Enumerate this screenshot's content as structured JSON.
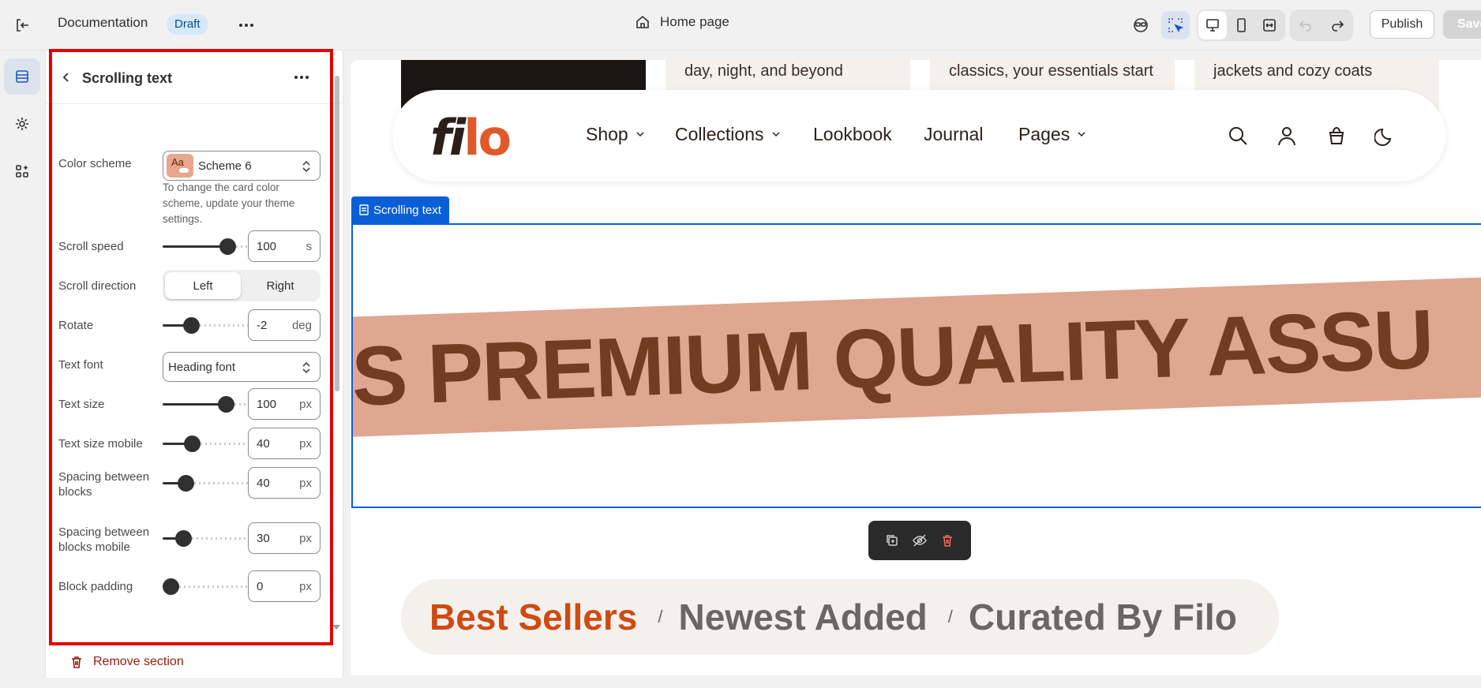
{
  "topbar": {
    "doc_name": "Documentation",
    "status_badge": "Draft",
    "page_name": "Home page",
    "publish_label": "Publish",
    "save_label": "Save"
  },
  "panel": {
    "title": "Scrolling text",
    "color_scheme": {
      "label": "Color scheme",
      "value": "Scheme 6",
      "swatch_text": "Aa",
      "help": "To change the card color scheme, update your theme settings."
    },
    "scroll_speed": {
      "label": "Scroll speed",
      "value": "100",
      "unit": "s",
      "fraction": 0.9
    },
    "scroll_direction": {
      "label": "Scroll direction",
      "options": [
        "Left",
        "Right"
      ],
      "selected": "Left"
    },
    "rotate": {
      "label": "Rotate",
      "value": "-2",
      "unit": "deg",
      "fraction": 0.32
    },
    "text_font": {
      "label": "Text font",
      "value": "Heading font"
    },
    "text_size": {
      "label": "Text size",
      "value": "100",
      "unit": "px",
      "fraction": 0.88
    },
    "text_size_mobile": {
      "label": "Text size mobile",
      "value": "40",
      "unit": "px",
      "fraction": 0.34
    },
    "spacing_blocks": {
      "label": "Spacing between blocks",
      "value": "40",
      "unit": "px",
      "fraction": 0.24
    },
    "spacing_blocks_mobile": {
      "label": "Spacing between blocks mobile",
      "value": "30",
      "unit": "px",
      "fraction": 0.2
    },
    "block_padding": {
      "label": "Block padding",
      "value": "0",
      "unit": "px",
      "fraction": 0.0
    },
    "remove_label": "Remove section"
  },
  "canvas": {
    "cards": [
      "day, night, and beyond",
      "classics, your essentials start",
      "jackets and cozy coats"
    ],
    "logo_a": "fi",
    "logo_b": "lo",
    "nav": [
      "Shop",
      "Collections",
      "Lookbook",
      "Journal",
      "Pages"
    ],
    "section_tag": "Scrolling text",
    "marquee": "ES  PREMIUM QUALITY ASSU",
    "tabs": [
      "Best Sellers",
      "Newest Added",
      "Curated By Filo"
    ],
    "tab_separator": "/"
  },
  "colors": {
    "accent": "#0b5fd6",
    "band": "#dfa690",
    "band_text": "#723b22",
    "logo_orange": "#e0592a",
    "highlight_frame": "#e60000"
  }
}
